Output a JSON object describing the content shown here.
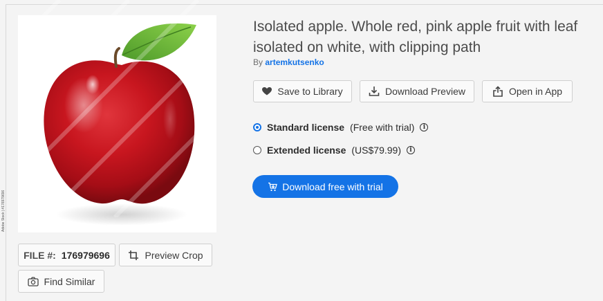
{
  "asset": {
    "title": "Isolated apple. Whole red, pink apple fruit with leaf isolated on white, with clipping path",
    "by_prefix": "By",
    "author": "artemkutsenko",
    "side_credit": "Adobe Stock | #176979696"
  },
  "actions": {
    "save_label": "Save to Library",
    "download_preview_label": "Download Preview",
    "open_in_app_label": "Open in App"
  },
  "licenses": [
    {
      "name": "Standard license",
      "note": "(Free with trial)",
      "selected": true
    },
    {
      "name": "Extended license",
      "note": "(US$79.99)",
      "selected": false
    }
  ],
  "cta": {
    "label": "Download free with trial"
  },
  "file": {
    "label": "FILE #:",
    "value": "176979696"
  },
  "tools": {
    "preview_crop_label": "Preview Crop",
    "find_similar_label": "Find Similar"
  },
  "colors": {
    "accent": "#1473e6",
    "background": "#f4f4f4"
  }
}
